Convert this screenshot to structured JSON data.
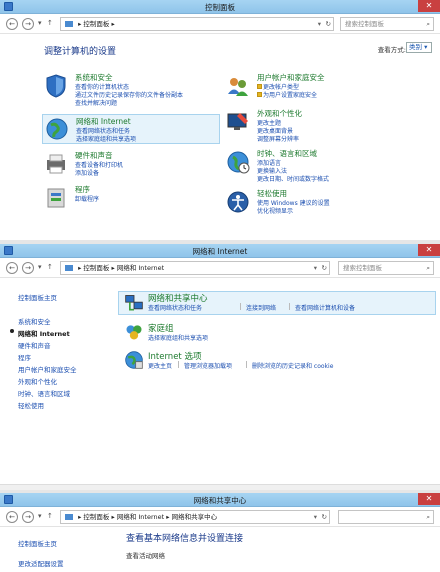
{
  "control_panel": {
    "title": "控制面板",
    "breadcrumb": "控制面板",
    "search_placeholder": "搜索控制面板",
    "heading": "调整计算机的设置",
    "view_by_label": "查看方式:",
    "view_by_value": "类别 ▾",
    "categories": [
      {
        "title": "系统和安全",
        "links": [
          "查看你的计算机状态",
          "通过文件历史记录保存你的文件备份副本",
          "查找并解决问题"
        ]
      },
      {
        "title": "网络和 Internet",
        "links": [
          "查看网络状态和任务",
          "选择家庭组和共享选项"
        ]
      },
      {
        "title": "硬件和声音",
        "links": [
          "查看设备和打印机",
          "添加设备"
        ]
      },
      {
        "title": "程序",
        "links": [
          "卸载程序"
        ]
      },
      {
        "title": "用户帐户和家庭安全",
        "links": [
          "更改帐户类型",
          "为用户设置家庭安全"
        ]
      },
      {
        "title": "外观和个性化",
        "links": [
          "更改主题",
          "更改桌面背景",
          "调整屏幕分辨率"
        ]
      },
      {
        "title": "时钟、语言和区域",
        "links": [
          "添加语言",
          "更换输入法",
          "更改日期、时间或数字格式"
        ]
      },
      {
        "title": "轻松使用",
        "links": [
          "使用 Windows 建议的设置",
          "优化视频显示"
        ]
      }
    ]
  },
  "network_internet": {
    "title": "网络和 Internet",
    "breadcrumb": [
      "控制面板",
      "网络和 Internet"
    ],
    "search_placeholder": "搜索控制面板",
    "sidebar": [
      "控制面板主页",
      "系统和安全",
      "网络和 Internet",
      "硬件和声音",
      "程序",
      "用户帐户和家庭安全",
      "外观和个性化",
      "时钟、语言和区域",
      "轻松使用"
    ],
    "items": [
      {
        "title": "网络和共享中心",
        "links": [
          "查看网络状态和任务",
          "连接到网络",
          "查看网络计算机和设备"
        ]
      },
      {
        "title": "家庭组",
        "links": [
          "选择家庭组和共享选项"
        ]
      },
      {
        "title": "Internet 选项",
        "links": [
          "更改主页",
          "管理浏览器加载项",
          "删除浏览的历史记录和 cookie"
        ]
      }
    ]
  },
  "sharing_center": {
    "title": "网络和共享中心",
    "breadcrumb": [
      "控制面板",
      "网络和 Internet",
      "网络和共享中心"
    ],
    "sidebar": [
      "控制面板主页",
      "更改适配器设置"
    ],
    "heading": "查看基本网络信息并设置连接",
    "subheading": "查看活动网络"
  },
  "colors": {
    "link": "#1c4fb0",
    "category_title": "#1d7a2e",
    "heading": "#1a3a8a",
    "titlebar": "#9ccdf0"
  }
}
